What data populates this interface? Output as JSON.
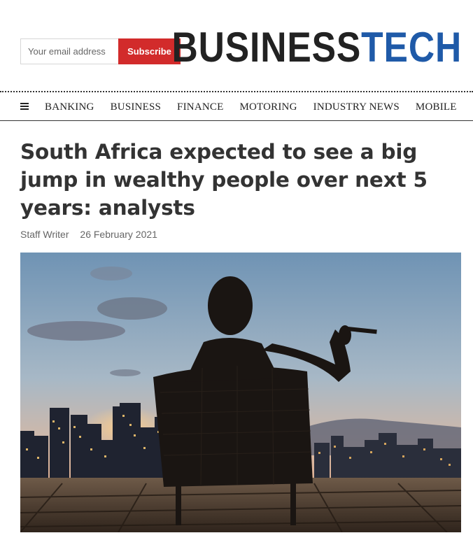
{
  "newsletter": {
    "email_placeholder": "Your email address",
    "subscribe_label": "Subscribe"
  },
  "brand": {
    "logo_part1": "BUSINESS",
    "logo_part2": "TECH",
    "colors": {
      "dark": "#222222",
      "accent": "#1f5aa8",
      "subscribe": "#d22b2b"
    }
  },
  "nav": {
    "menu_icon": "hamburger-icon",
    "items": [
      "BANKING",
      "BUSINESS",
      "FINANCE",
      "MOTORING",
      "INDUSTRY NEWS",
      "MOBILE"
    ]
  },
  "article": {
    "headline": "South Africa expected to see a big jump in wealthy people over next 5 years: analysts",
    "author": "Staff Writer",
    "date": "26 February 2021"
  }
}
